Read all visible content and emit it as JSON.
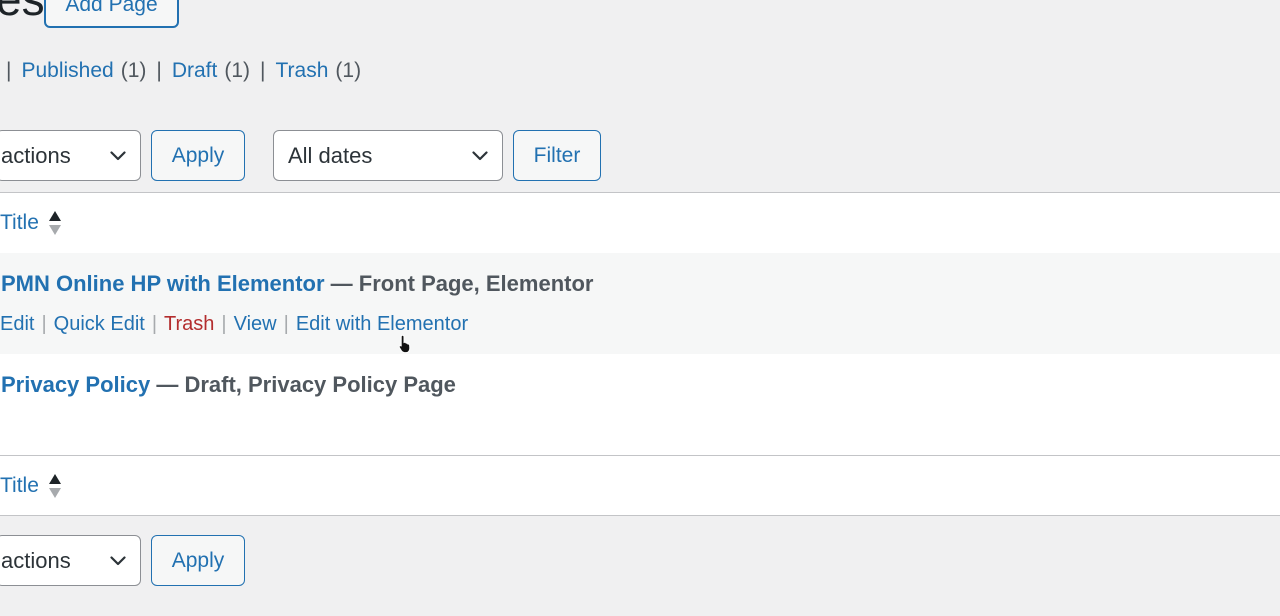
{
  "header": {
    "title": "es",
    "add_new_label": "Add Page"
  },
  "views": [
    {
      "label": "Published",
      "count": "(1)"
    },
    {
      "label": "Draft",
      "count": "(1)"
    },
    {
      "label": "Trash",
      "count": "(1)"
    }
  ],
  "top_nav": {
    "bulk_actions": "actions",
    "apply_label": "Apply",
    "dates_filter": "All dates",
    "filter_label": "Filter"
  },
  "table": {
    "column_title": "Title",
    "rows": [
      {
        "title": "PMN Online HP with Elementor",
        "state": " — Front Page, Elementor",
        "actions": [
          "Edit",
          "Quick Edit",
          "Trash",
          "View",
          "Edit with Elementor"
        ]
      },
      {
        "title": "Privacy Policy",
        "state": " — Draft, Privacy Policy Page"
      }
    ],
    "footer_column_title": "Title"
  },
  "bottom_nav": {
    "bulk_actions": "actions",
    "apply_label": "Apply"
  },
  "colors": {
    "link": "#2271b1",
    "trash": "#b32d2e",
    "background": "#f0f0f1"
  }
}
